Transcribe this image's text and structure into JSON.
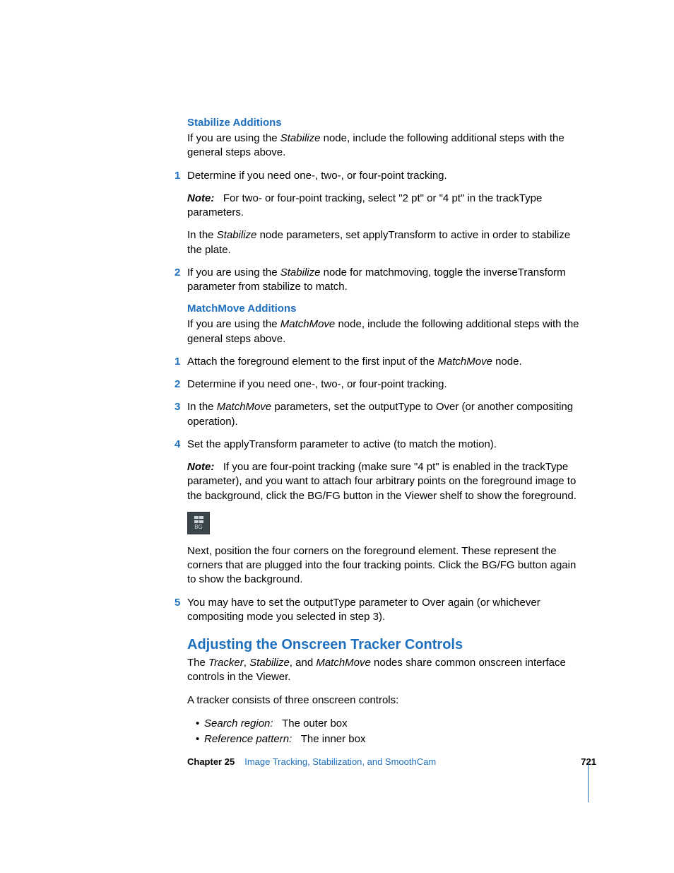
{
  "sections": {
    "stabilize": {
      "heading": "Stabilize Additions",
      "intro_parts": [
        "If you are using the ",
        "Stabilize",
        " node, include the following additional steps with the general steps above."
      ],
      "steps": [
        {
          "num": "1",
          "text": "Determine if you need one-, two-, or four-point tracking.",
          "after": [
            {
              "note_label": "Note:",
              "text": "For two- or four-point tracking, select \"2 pt\" or \"4 pt\" in the trackType parameters."
            },
            {
              "parts": [
                "In the ",
                "Stabilize",
                " node parameters, set applyTransform to active in order to stabilize the plate."
              ]
            }
          ]
        },
        {
          "num": "2",
          "parts": [
            "If you are using the ",
            "Stabilize",
            " node for matchmoving, toggle the inverseTransform parameter from stabilize to match."
          ]
        }
      ]
    },
    "matchmove": {
      "heading": "MatchMove Additions",
      "intro_parts": [
        "If you are using the ",
        "MatchMove",
        " node, include the following additional steps with the general steps above."
      ],
      "steps": [
        {
          "num": "1",
          "parts": [
            "Attach the foreground element to the first input of the ",
            "MatchMove",
            " node."
          ]
        },
        {
          "num": "2",
          "text": "Determine if you need one-, two-, or four-point tracking."
        },
        {
          "num": "3",
          "parts": [
            "In the ",
            "MatchMove",
            " parameters, set the outputType to Over (or another compositing operation)."
          ]
        },
        {
          "num": "4",
          "text": "Set the applyTransform parameter to active (to match the motion).",
          "after": [
            {
              "note_label": "Note:",
              "text": "If you are four-point tracking (make sure \"4 pt\" is enabled in the trackType parameter), and you want to attach four arbitrary points on the foreground image to the background, click the BG/FG button in the Viewer shelf to show the foreground."
            }
          ],
          "icon_label": "BG",
          "after_icon": "Next, position the four corners on the foreground element. These represent the corners that are plugged into the four tracking points. Click the BG/FG button again to show the background."
        },
        {
          "num": "5",
          "text": "You may have to set the outputType parameter to Over again (or whichever compositing mode you selected in step 3)."
        }
      ]
    },
    "adjusting": {
      "title": "Adjusting the Onscreen Tracker Controls",
      "intro_parts": [
        "The ",
        "Tracker",
        ", ",
        "Stabilize",
        ", and ",
        "MatchMove",
        " nodes share common onscreen interface controls in the Viewer."
      ],
      "line": "A tracker consists of three onscreen controls:",
      "bullets": [
        {
          "term": "Search region:",
          "desc": "The outer box"
        },
        {
          "term": "Reference pattern:",
          "desc": "The inner box"
        }
      ]
    }
  },
  "footer": {
    "chapter_label": "Chapter 25",
    "chapter_title": "Image Tracking, Stabilization, and SmoothCam",
    "page": "721"
  }
}
